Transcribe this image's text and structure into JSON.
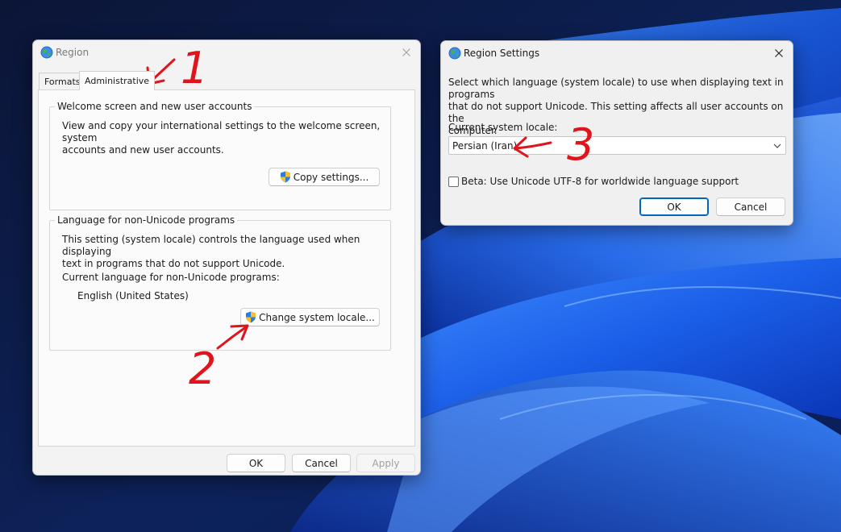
{
  "region_window": {
    "title": "Region",
    "tabs": [
      {
        "label": "Formats"
      },
      {
        "label": "Administrative"
      }
    ],
    "welcome_group": {
      "legend": "Welcome screen and new user accounts",
      "description_line1": "View and copy your international settings to the welcome screen, system",
      "description_line2": "accounts and new user accounts.",
      "copy_button": "Copy settings..."
    },
    "nonunicode_group": {
      "legend": "Language for non-Unicode programs",
      "description_line1": "This setting (system locale) controls the language used when displaying",
      "description_line2": "text in programs that do not support Unicode.",
      "current_label": "Current language for non-Unicode programs:",
      "current_value": "English (United States)",
      "change_button": "Change system locale..."
    },
    "footer": {
      "ok": "OK",
      "cancel": "Cancel",
      "apply": "Apply"
    }
  },
  "settings_window": {
    "title": "Region Settings",
    "description_line1": "Select which language (system locale) to use when displaying text in programs",
    "description_line2": "that do not support Unicode. This setting affects all user accounts on the",
    "description_line3": "computer.",
    "locale_label": "Current system locale:",
    "locale_value": "Persian (Iran)",
    "beta_checkbox_label": "Beta: Use Unicode UTF-8 for worldwide language support",
    "beta_checked": false,
    "ok": "OK",
    "cancel": "Cancel"
  },
  "annotations": {
    "step1": "1",
    "step2": "2",
    "step3": "3",
    "color": "#e0141c"
  },
  "theme": {
    "accent": "#0067c0",
    "window_bg": "#f3f3f3",
    "wallpaper_dark": "#0a1a44",
    "wallpaper_blue": "#1e63e6"
  }
}
